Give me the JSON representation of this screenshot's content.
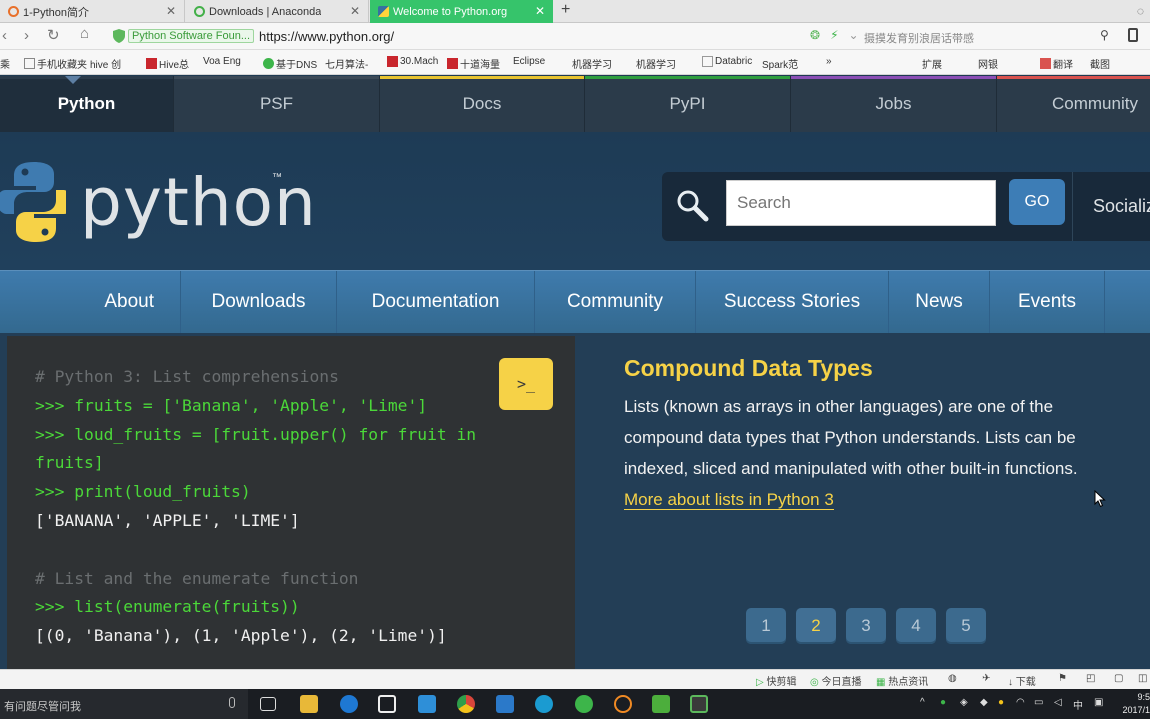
{
  "browser": {
    "tabs": [
      {
        "title": "1-Python简介",
        "icon_color": "#e8702a"
      },
      {
        "title": "Downloads | Anaconda",
        "icon_color": "#43b049"
      },
      {
        "title": "Welcome to Python.org",
        "icon_color": "#ffd43b"
      }
    ],
    "new_tab": "+",
    "security_label": "Python Software Foun...",
    "url": "https://www.python.org/",
    "search_hint": "摄摸发育别浪居话带感",
    "bookmarks": [
      "乘",
      "手机收藏夹",
      "hive 创",
      "Hive总",
      "Voa Eng",
      "基于DNS",
      "七月算法-",
      "30.Mach",
      "十道海量",
      "Eclipse",
      "机器学习",
      "机器学习",
      "Databric",
      "Spark范",
      "»",
      "扩展",
      "网银",
      "翻译",
      "截图"
    ],
    "status_items": [
      "快剪辑",
      "今日直播",
      "热点资讯",
      "下载"
    ]
  },
  "site": {
    "top_nav": [
      "Python",
      "PSF",
      "Docs",
      "PyPI",
      "Jobs",
      "Community"
    ],
    "top_nav_colors": [
      "#2b3b4a",
      "#2b3b4a",
      "#e8c330",
      "#2f9e3f",
      "#8b4fb5",
      "#d9534f"
    ],
    "logo_text": "python",
    "logo_tm": "™",
    "search_placeholder": "Search",
    "go_label": "GO",
    "social_label": "Socialize",
    "main_nav": [
      "About",
      "Downloads",
      "Documentation",
      "Community",
      "Success Stories",
      "News",
      "Events"
    ],
    "code_lines": [
      {
        "text": "# Python 3: List comprehensions",
        "kind": "com"
      },
      {
        "text": ">>> fruits = ['Banana', 'Apple', 'Lime']",
        "kind": "in"
      },
      {
        "text": ">>> loud_fruits = [fruit.upper() for fruit in",
        "kind": "in"
      },
      {
        "text": "fruits]",
        "kind": "in"
      },
      {
        "text": ">>> print(loud_fruits)",
        "kind": "in"
      },
      {
        "text": "['BANANA', 'APPLE', 'LIME']",
        "kind": "out"
      },
      {
        "text": "",
        "kind": "out"
      },
      {
        "text": "# List and the enumerate function",
        "kind": "com"
      },
      {
        "text": ">>> list(enumerate(fruits))",
        "kind": "in"
      },
      {
        "text": "[(0, 'Banana'), (1, 'Apple'), (2, 'Lime')]",
        "kind": "out"
      }
    ],
    "terminal_button": ">_",
    "info_title": "Compound Data Types",
    "info_body": "Lists (known as arrays in other languages) are one of the compound data types that Python understands. Lists can be indexed, sliced and manipulated with other built-in functions. ",
    "info_link": "More about lists in Python 3",
    "pages": [
      "1",
      "2",
      "3",
      "4",
      "5"
    ],
    "active_page": "2"
  },
  "taskbar": {
    "ask_text": "有问题尽管问我",
    "clock_time": "9:5",
    "clock_date": "2017/1"
  }
}
